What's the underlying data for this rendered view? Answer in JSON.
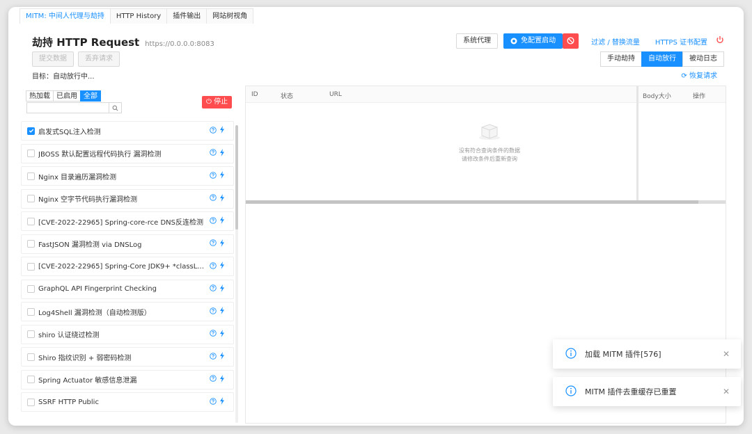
{
  "tabs": [
    {
      "label": "MITM: 中间人代理与劫持",
      "active": true
    },
    {
      "label": "HTTP History",
      "active": false
    },
    {
      "label": "插件输出",
      "active": false
    },
    {
      "label": "网站树视角",
      "active": false
    }
  ],
  "header": {
    "title": "劫持 HTTP Request",
    "address": "https://0.0.0.0:8083",
    "submit_label": "提交数据",
    "discard_label": "丢弃请求",
    "target": "目标：自动放行中..."
  },
  "actions": {
    "system_proxy": "系统代理",
    "start_label": "免配置启动",
    "filter_link": "过滤 / 替换流量",
    "https_link": "HTTPS 证书配置",
    "mode_manual": "手动劫持",
    "mode_auto": "自动放行",
    "mode_passive": "被动日志",
    "restore": "恢复请求"
  },
  "plugins": {
    "filters": [
      "热加载",
      "已启用",
      "全部"
    ],
    "active_filter": "全部",
    "search_placeholder": "",
    "stop_label": "停止",
    "items": [
      {
        "name": "启发式SQL注入检测",
        "checked": true
      },
      {
        "name": "JBOSS 默认配置远程代码执行 漏洞检测",
        "checked": false
      },
      {
        "name": "Nginx 目录遍历漏洞检测",
        "checked": false
      },
      {
        "name": "Nginx 空字节代码执行漏洞检测",
        "checked": false
      },
      {
        "name": "[CVE-2022-22965] Spring-core-rce DNS反连检测",
        "checked": false
      },
      {
        "name": "FastJSON 漏洞检测 via DNSLog",
        "checked": false
      },
      {
        "name": "[CVE-2022-22965] Spring-Core JDK9+ *classLoa...",
        "checked": false
      },
      {
        "name": "GraphQL API Fingerprint Checking",
        "checked": false
      },
      {
        "name": "Log4Shell 漏洞检测（自动检测版）",
        "checked": false
      },
      {
        "name": "shiro 认证绕过检测",
        "checked": false
      },
      {
        "name": "Shiro 指纹识别 + 弱密码检测",
        "checked": false
      },
      {
        "name": "Spring Actuator 敏感信息泄漏",
        "checked": false
      },
      {
        "name": "SSRF HTTP Public",
        "checked": false
      }
    ]
  },
  "table": {
    "columns": {
      "id": "ID",
      "status": "状态",
      "url": "URL",
      "body_size": "Body大小",
      "action": "操作"
    },
    "empty_line1": "没有符合查询条件的数据",
    "empty_line2": "请修改条件后重新查询"
  },
  "notifications": [
    {
      "message": "加载 MITM 插件[576]"
    },
    {
      "message": "MITM 插件去重缓存已重置"
    }
  ],
  "colors": {
    "primary": "#1890ff",
    "danger": "#ff4d4f"
  }
}
